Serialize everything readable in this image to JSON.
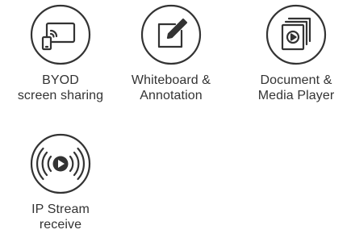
{
  "features": [
    {
      "icon": "byod-screen-share-icon",
      "line1": "BYOD",
      "line2": "screen sharing"
    },
    {
      "icon": "whiteboard-pen-icon",
      "line1": "Whiteboard &",
      "line2": "Annotation"
    },
    {
      "icon": "document-media-player-icon",
      "line1": "Document &",
      "line2": "Media Player"
    },
    {
      "icon": "ip-stream-broadcast-icon",
      "line1": "IP Stream",
      "line2": "receive"
    }
  ],
  "colors": {
    "icon_stroke": "#333333",
    "text": "#333333",
    "background": "#ffffff"
  }
}
